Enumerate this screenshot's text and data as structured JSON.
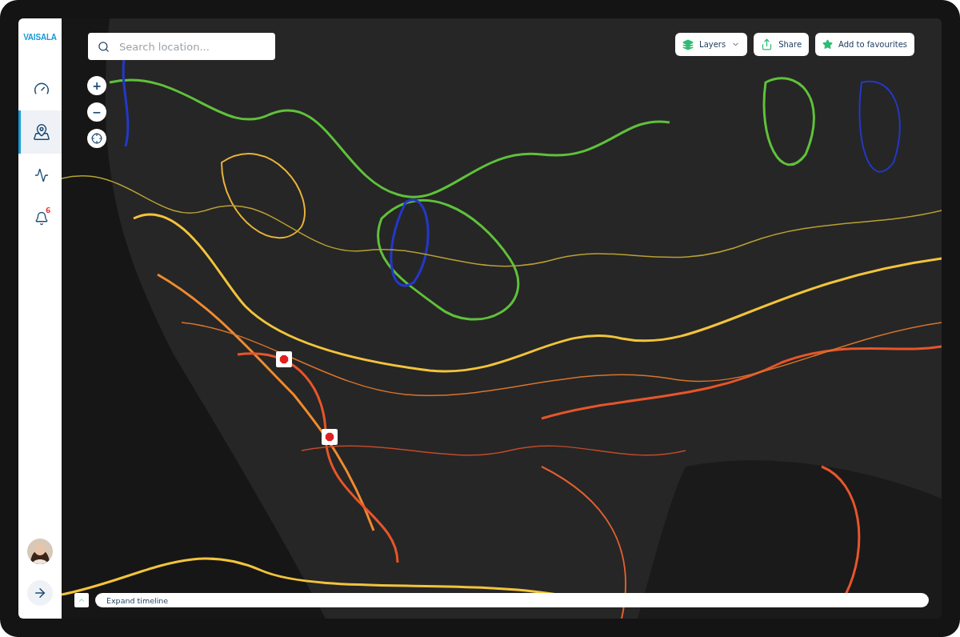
{
  "sidebar": {
    "logo": "VAISALA",
    "items": [
      {
        "kind": "gauge",
        "selected": false
      },
      {
        "kind": "map",
        "selected": true
      },
      {
        "kind": "pulse",
        "selected": false
      },
      {
        "kind": "bell",
        "selected": false,
        "badge": "6"
      }
    ],
    "footer": {
      "kind": "avatar"
    }
  },
  "map": {
    "kind": "picture",
    "search": {
      "placeholder": "Search location..."
    },
    "zoom_controls": [
      {
        "kind": "zoom-in",
        "label": "+"
      },
      {
        "kind": "zoom-out",
        "label": "−"
      },
      {
        "kind": "locate"
      }
    ],
    "toolbar": [
      {
        "kind": "layers",
        "label": "Layers"
      },
      {
        "kind": "share",
        "label": "Share"
      },
      {
        "kind": "favourite",
        "label": "Add to favourites"
      }
    ],
    "alerts": [
      {
        "kind": "warning"
      },
      {
        "kind": "warning"
      }
    ]
  },
  "timeline": {
    "label": "Expand timeline",
    "expanded": false
  }
}
